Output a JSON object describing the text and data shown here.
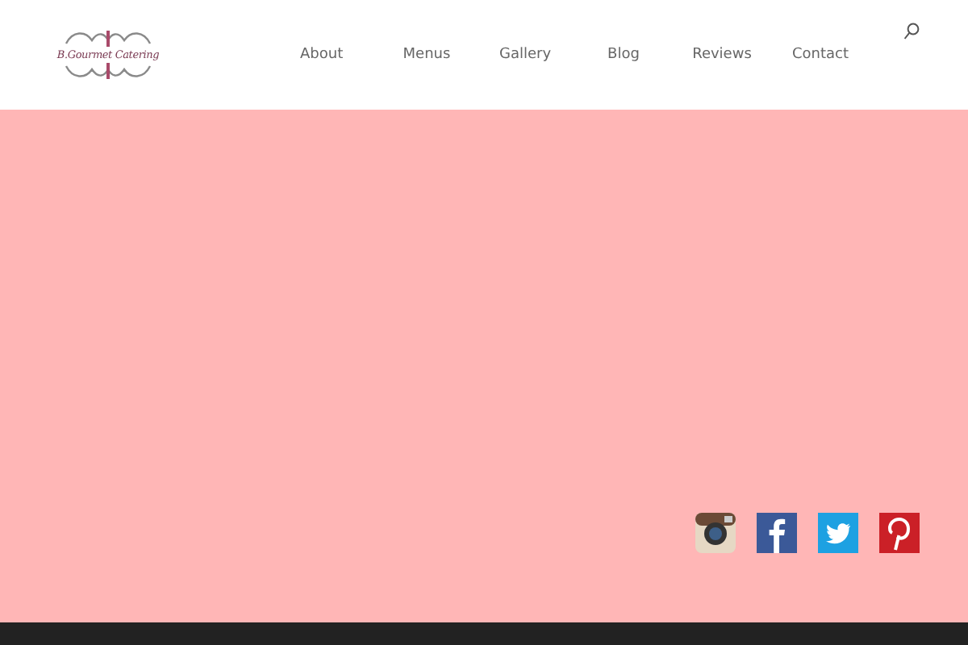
{
  "header": {
    "logo_text": "B.Gourmet Catering",
    "nav": [
      {
        "label": "About"
      },
      {
        "label": "Menus"
      },
      {
        "label": "Gallery"
      },
      {
        "label": "Blog"
      },
      {
        "label": "Reviews"
      },
      {
        "label": "Contact"
      }
    ]
  },
  "social_links": [
    {
      "kind": "instagram"
    },
    {
      "kind": "facebook"
    },
    {
      "kind": "twitter"
    },
    {
      "kind": "pinterest"
    }
  ]
}
